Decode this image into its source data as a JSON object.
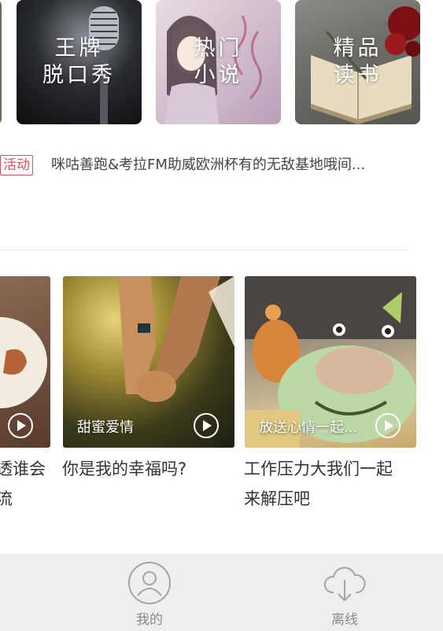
{
  "tiles": [
    {
      "label": "王牌\n脱口秀"
    },
    {
      "label": "热门\n小说"
    },
    {
      "label": "精品\n读书"
    }
  ],
  "promo": {
    "badge": "活动",
    "text": "咪咕善跑&考拉FM助威欧洲杯有的无敌基地哦间..."
  },
  "cards": [
    {
      "title_line1": "透谁会",
      "title_line2": "流"
    },
    {
      "caption": "甜蜜爱情",
      "title": "你是我的幸福吗?"
    },
    {
      "caption": "放送心情一起...",
      "title_line1": "工作压力大我们一起",
      "title_line2": "来解压吧"
    }
  ],
  "nav": [
    {
      "label": "我的",
      "icon": "profile-icon"
    },
    {
      "label": "离线",
      "icon": "cloud-download-icon"
    }
  ],
  "colors": {
    "accent": "#e0555b",
    "nav_bg": "#eeeeee",
    "nav_text": "#8a8a8a"
  }
}
